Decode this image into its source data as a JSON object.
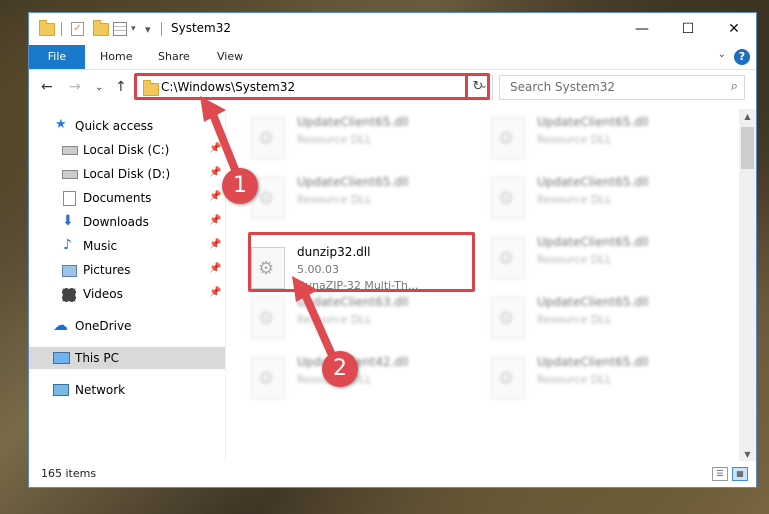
{
  "window": {
    "title": "System32",
    "controls": {
      "minimize": "—",
      "maximize": "☐",
      "close": "✕"
    }
  },
  "ribbon": {
    "file": "File",
    "tabs": [
      "Home",
      "Share",
      "View"
    ],
    "help": "?",
    "expand": "⌄"
  },
  "nav": {
    "back": "←",
    "forward": "→",
    "recent": "⌄",
    "up": "↑",
    "address": "C:\\Windows\\System32",
    "address_dropdown": "⌄",
    "refresh": "↻",
    "search_placeholder": "Search System32",
    "search_icon": "⌕"
  },
  "sidebar": {
    "items": [
      {
        "label": "Quick access",
        "icon": "star-icon",
        "pinned": false
      },
      {
        "label": "Local Disk (C:)",
        "icon": "drive-icon",
        "pinned": true
      },
      {
        "label": "Local Disk (D:)",
        "icon": "drive-icon",
        "pinned": true
      },
      {
        "label": "Documents",
        "icon": "documents-icon",
        "pinned": true
      },
      {
        "label": "Downloads",
        "icon": "download-icon",
        "pinned": true
      },
      {
        "label": "Music",
        "icon": "music-icon",
        "pinned": true
      },
      {
        "label": "Pictures",
        "icon": "pictures-icon",
        "pinned": true
      },
      {
        "label": "Videos",
        "icon": "videos-icon",
        "pinned": true
      },
      {
        "label": "OneDrive",
        "icon": "cloud-icon",
        "pinned": false
      },
      {
        "label": "This PC",
        "icon": "computer-icon",
        "pinned": false,
        "selected": true
      },
      {
        "label": "Network",
        "icon": "network-icon",
        "pinned": false
      }
    ],
    "pin_glyph": "📌"
  },
  "files": {
    "highlighted": {
      "name": "dunzip32.dll",
      "version": "5.00.03",
      "description": "DynaZIP-32 Multi-Th..."
    },
    "background": [
      {
        "name": "UpdateClient65.dll",
        "description": "Resource DLL"
      },
      {
        "name": "UpdateClient65.dll",
        "description": "Resource DLL"
      },
      {
        "name": "UpdateClient65.dll",
        "description": "Resource DLL"
      },
      {
        "name": "UpdateClient65.dll",
        "description": "Resource DLL"
      },
      {
        "name": "UpdateClient65.dll",
        "description": "Resource DLL"
      },
      {
        "name": "UpdateClient63.dll",
        "description": "Resource DLL"
      },
      {
        "name": "UpdateClient65.dll",
        "description": "Resource DLL"
      },
      {
        "name": "UpdateClient42.dll",
        "description": "Resource DLL"
      },
      {
        "name": "UpdateClient65.dll",
        "description": "Resource DLL"
      }
    ]
  },
  "status": {
    "count": "165 items"
  },
  "annotations": {
    "step1": "1",
    "step2": "2",
    "highlight_color": "#d9434a"
  },
  "colors": {
    "accent": "#1979ca",
    "selection": "#d9d9d9"
  }
}
